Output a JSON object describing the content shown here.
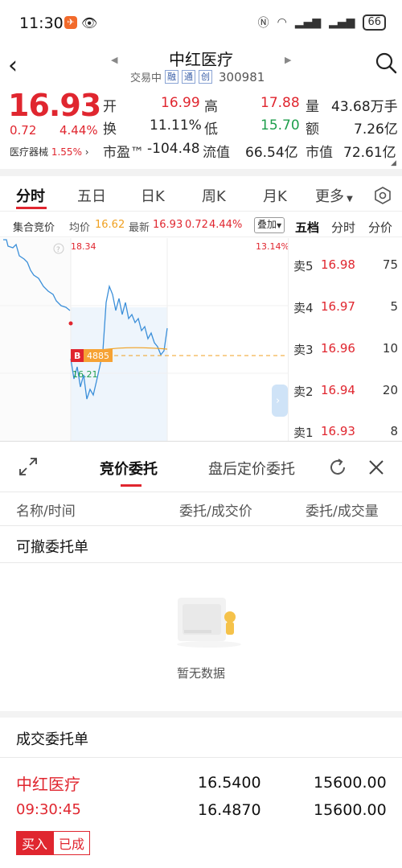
{
  "status_bar": {
    "time": "11:30",
    "app_badge": "✈",
    "battery": "66"
  },
  "header": {
    "title": "中红医疗",
    "trading_status": "交易中",
    "tags": [
      "融",
      "通",
      "创"
    ],
    "code": "300981"
  },
  "quote": {
    "price": "16.93",
    "change": "0.72",
    "change_pct": "4.44%",
    "sector_name": "医疗器械",
    "sector_pct": "1.55%",
    "stats": {
      "open_label": "开",
      "open": "16.99",
      "high_label": "高",
      "high": "17.88",
      "volume_label": "量",
      "volume": "43.68万手",
      "turnover_label": "换",
      "turnover": "11.11%",
      "low_label": "低",
      "low": "15.70",
      "amount_label": "额",
      "amount": "7.26亿",
      "pe_label": "市盈™",
      "pe": "-104.48",
      "float_cap_label": "流值",
      "float_cap": "66.54亿",
      "mkt_cap_label": "市值",
      "mkt_cap": "72.61亿"
    }
  },
  "period_tabs": [
    "分时",
    "五日",
    "日K",
    "周K",
    "月K",
    "更多"
  ],
  "chart_header": {
    "auction_label": "集合竞价",
    "avg_label": "均价",
    "avg": "16.62",
    "last_label": "最新",
    "last": "16.93",
    "last_chg": "0.72",
    "last_pct": "4.44%",
    "overlay": "叠加"
  },
  "orderbook_tabs": [
    "五档",
    "分时",
    "分价"
  ],
  "chart": {
    "max_price": "18.34",
    "max_pct": "13.14%",
    "marker_label": "B",
    "marker_value": "4885",
    "low_price": "16.21"
  },
  "orderbook": [
    {
      "level": "卖5",
      "price": "16.98",
      "vol": "75"
    },
    {
      "level": "卖4",
      "price": "16.97",
      "vol": "5"
    },
    {
      "level": "卖3",
      "price": "16.96",
      "vol": "10"
    },
    {
      "level": "卖2",
      "price": "16.94",
      "vol": "20"
    },
    {
      "level": "卖1",
      "price": "16.93",
      "vol": "8"
    }
  ],
  "sheet": {
    "tabs": [
      "竞价委托",
      "盘后定价委托"
    ],
    "columns": [
      "名称/时间",
      "委托/成交价",
      "委托/成交量"
    ],
    "cancelable_title": "可撤委托单",
    "empty_text": "暂无数据",
    "filled_title": "成交委托单",
    "filled": {
      "name": "中红医疗",
      "time": "09:30:45",
      "order_price": "16.5400",
      "deal_price": "16.4870",
      "order_qty": "15600.00",
      "deal_qty": "15600.00",
      "side": "买入",
      "state": "已成"
    }
  },
  "colors": {
    "up": "#e0262f",
    "down": "#1f9e4c",
    "accent": "#e0262f",
    "line": "#3b8fd9",
    "avg_line": "#f0a020"
  }
}
